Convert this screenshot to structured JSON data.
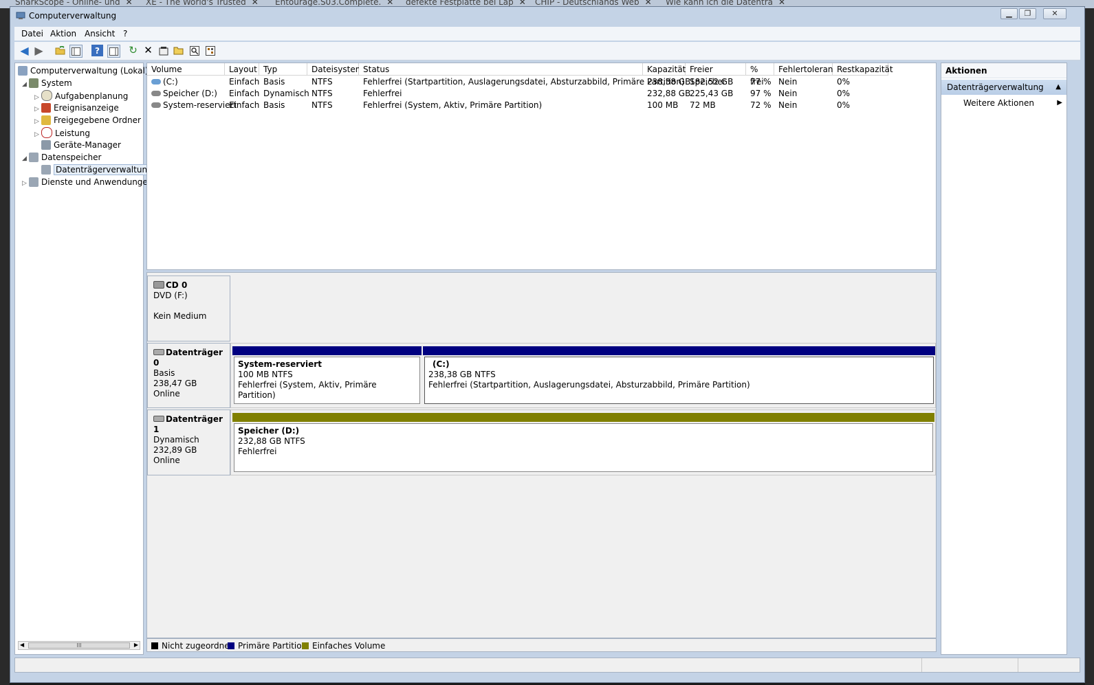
{
  "browser_tabs": [
    {
      "label": "SharkScope - Online- und"
    },
    {
      "label": "XE - The World's Trusted"
    },
    {
      "label": "Entourage.S03.Complete."
    },
    {
      "label": "defekte Festplatte bei Lap"
    },
    {
      "label": "CHIP - Deutschlands Web"
    },
    {
      "label": "Wie kann ich die Datentra"
    }
  ],
  "window": {
    "title": "Computerverwaltung",
    "icon": "computer-management-icon"
  },
  "menu": [
    "Datei",
    "Aktion",
    "Ansicht",
    "?"
  ],
  "toolbar": [
    "back-icon",
    "forward-icon",
    "up-folder-icon",
    "show-hide-tree-icon",
    "help-icon",
    "show-hide-action-pane-icon",
    "refresh-icon",
    "delete-icon",
    "properties-icon",
    "open-icon",
    "search-icon",
    "settings-icon"
  ],
  "tree": {
    "root": "Computerverwaltung (Lokal)",
    "system": "System",
    "aufgaben": "Aufgabenplanung",
    "ereignis": "Ereignisanzeige",
    "freigegeben": "Freigegebene Ordner",
    "leistung": "Leistung",
    "geraete": "Geräte-Manager",
    "datenspeicher": "Datenspeicher",
    "datentraeger": "Datenträgerverwaltung",
    "dienste": "Dienste und Anwendungen"
  },
  "volume_list": {
    "columns": [
      "Volume",
      "Layout",
      "Typ",
      "Dateisystem",
      "Status",
      "Kapazität",
      "Freier Speicher",
      "% frei",
      "Fehlertoleranz",
      "Restkapazität"
    ],
    "rows": [
      [
        "(C:)",
        "Einfach",
        "Basis",
        "NTFS",
        "Fehlerfrei (Startpartition, Auslagerungsdatei, Absturzabbild, Primäre Partition)",
        "238,38 GB",
        "182,52 GB",
        "77 %",
        "Nein",
        "0%"
      ],
      [
        "Speicher (D:)",
        "Einfach",
        "Dynamisch",
        "NTFS",
        "Fehlerfrei",
        "232,88 GB",
        "225,43 GB",
        "97 %",
        "Nein",
        "0%"
      ],
      [
        "System-reserviert",
        "Einfach",
        "Basis",
        "NTFS",
        "Fehlerfrei (System, Aktiv, Primäre Partition)",
        "100 MB",
        "72 MB",
        "72 %",
        "Nein",
        "0%"
      ]
    ]
  },
  "disks": {
    "cd0": {
      "name": "CD 0",
      "type": "DVD (F:)",
      "status": "Kein Medium"
    },
    "disk0": {
      "name": "Datenträger 0",
      "kind": "Basis",
      "size": "238,47 GB",
      "status": "Online",
      "part1": {
        "title": "System-reserviert",
        "size": "100 MB NTFS",
        "state": "Fehlerfrei (System, Aktiv, Primäre Partition)"
      },
      "part2": {
        "title": "(C:)",
        "size": "238,38 GB NTFS",
        "state": "Fehlerfrei (Startpartition, Auslagerungsdatei, Absturzabbild, Primäre Partition)"
      }
    },
    "disk1": {
      "name": "Datenträger 1",
      "kind": "Dynamisch",
      "size": "232,89 GB",
      "status": "Online",
      "part1": {
        "title": "Speicher  (D:)",
        "size": "232,88 GB NTFS",
        "state": "Fehlerfrei"
      }
    }
  },
  "legend": {
    "unallocated": "Nicht zugeordnet",
    "primary": "Primäre Partition",
    "simple": "Einfaches Volume"
  },
  "colors": {
    "unallocated": "#000000",
    "primary": "#000080",
    "simple": "#808000"
  },
  "actions": {
    "header": "Aktionen",
    "section": "Datenträgerverwaltung",
    "more": "Weitere Aktionen"
  }
}
